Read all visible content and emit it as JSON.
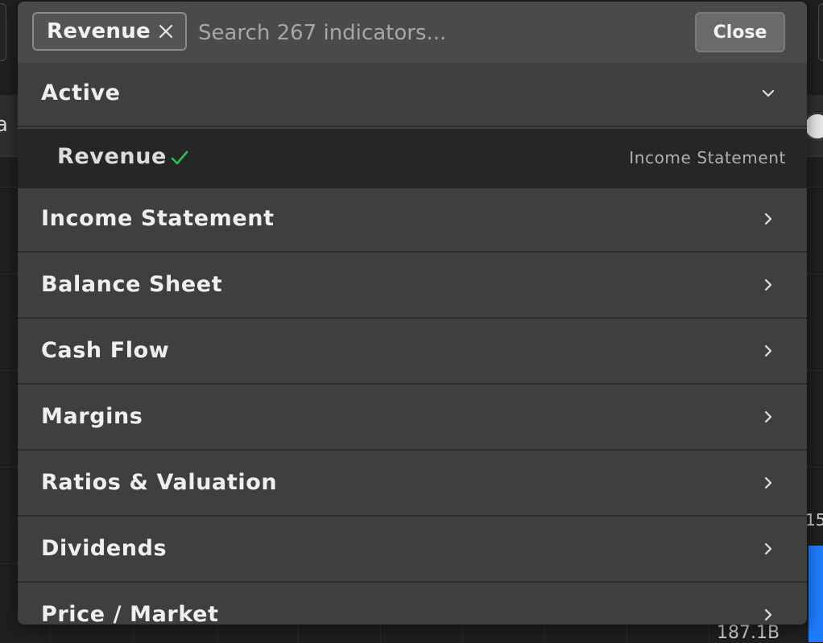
{
  "background": {
    "left_label": "a",
    "chart_top_label": "15",
    "chart_bottom_label": "187.1B",
    "bar_color": "#1e7dff"
  },
  "selector": {
    "chip": {
      "label": "Revenue",
      "remove_icon": "close-icon"
    },
    "search": {
      "placeholder": "Search 267 indicators...",
      "value": ""
    },
    "close_label": "Close",
    "active_section": {
      "label": "Active",
      "icon": "chevron-down-icon",
      "items": [
        {
          "label": "Revenue",
          "category": "Income Statement",
          "status_icon": "check-icon",
          "check_color": "#2fbf5a"
        }
      ]
    },
    "categories": [
      {
        "label": "Income Statement",
        "icon": "chevron-right-icon"
      },
      {
        "label": "Balance Sheet",
        "icon": "chevron-right-icon"
      },
      {
        "label": "Cash Flow",
        "icon": "chevron-right-icon"
      },
      {
        "label": "Margins",
        "icon": "chevron-right-icon"
      },
      {
        "label": "Ratios & Valuation",
        "icon": "chevron-right-icon"
      },
      {
        "label": "Dividends",
        "icon": "chevron-right-icon"
      },
      {
        "label": "Price / Market",
        "icon": "chevron-right-icon"
      }
    ]
  }
}
